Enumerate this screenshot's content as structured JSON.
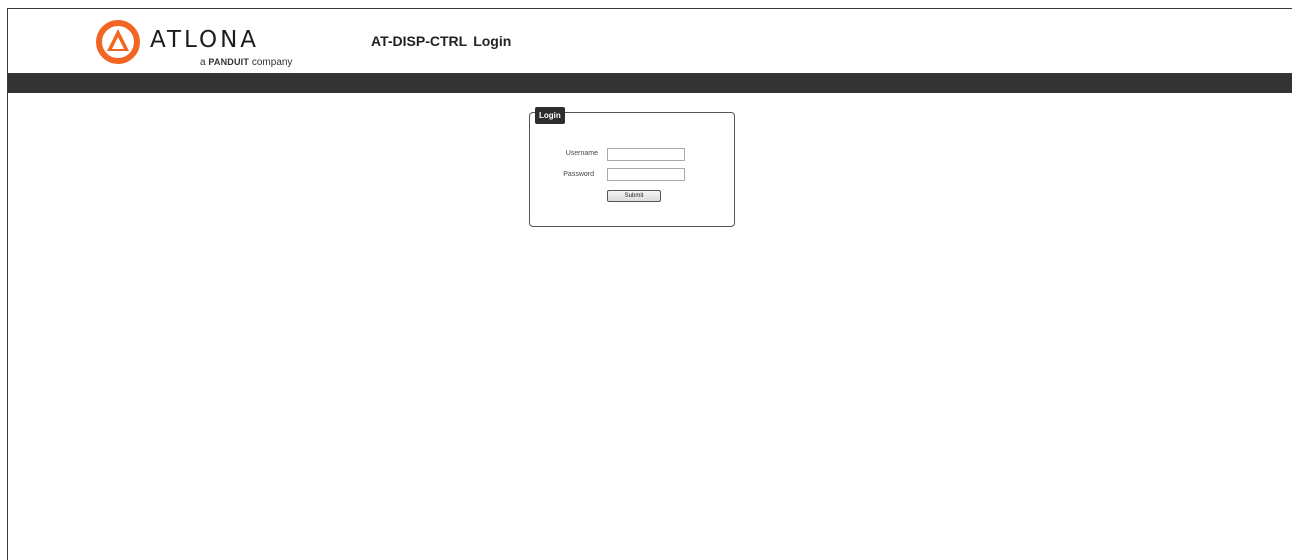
{
  "brand": {
    "name": "ATLONA",
    "tagline_prefix": "a",
    "tagline_brand": "PANDUIT",
    "tagline_suffix": "company",
    "accent_color": "#f26522"
  },
  "header": {
    "product": "AT-DISP-CTRL",
    "page": "Login"
  },
  "login": {
    "legend": "Login",
    "username_label": "Username",
    "username_value": "",
    "password_label": "Password",
    "password_value": "",
    "submit_label": "Submit"
  },
  "colors": {
    "nav_bar": "#333333",
    "legend_bg": "#2d2d2d"
  }
}
